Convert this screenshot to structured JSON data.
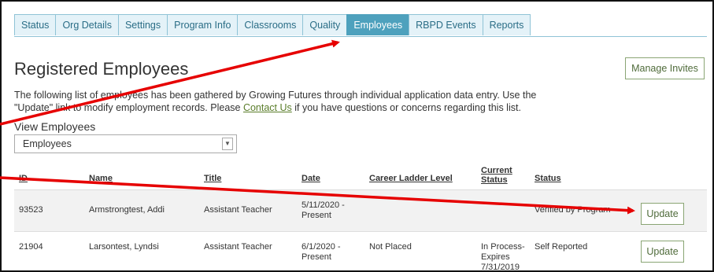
{
  "tabs": [
    {
      "label": "Status",
      "active": false
    },
    {
      "label": "Org Details",
      "active": false
    },
    {
      "label": "Settings",
      "active": false
    },
    {
      "label": "Program Info",
      "active": false
    },
    {
      "label": "Classrooms",
      "active": false
    },
    {
      "label": "Quality",
      "active": false
    },
    {
      "label": "Employees",
      "active": true
    },
    {
      "label": "RBPD Events",
      "active": false
    },
    {
      "label": "Reports",
      "active": false
    }
  ],
  "page": {
    "title": "Registered Employees",
    "manage_invites": "Manage Invites",
    "desc_part1": "The following list of employees has been gathered by Growing Futures through individual application data entry. Use the \"Update\" link to modify employment records. Please ",
    "desc_link": "Contact Us",
    "desc_part2": " if you have questions or concerns regarding this list."
  },
  "view": {
    "label": "View Employees",
    "selected": "Employees"
  },
  "table": {
    "headers": {
      "id": "ID",
      "name": "Name",
      "title": "Title",
      "date": "Date",
      "career": "Career Ladder Level",
      "current1": "Current",
      "current2": "Status",
      "status": "Status"
    },
    "rows": [
      {
        "id": "93523",
        "name": "Armstrongtest, Addi",
        "title": "Assistant Teacher",
        "date1": "5/11/2020 -",
        "date2": "Present",
        "career": "",
        "cur1": "",
        "cur2": "",
        "cur3": "",
        "status": "Verified by Program",
        "action": "Update"
      },
      {
        "id": "21904",
        "name": "Larsontest, Lyndsi",
        "title": "Assistant Teacher",
        "date1": "6/1/2020 -",
        "date2": "Present",
        "career": "Not Placed",
        "cur1": "In Process-",
        "cur2": "Expires",
        "cur3": "7/31/2019",
        "status": "Self Reported",
        "action": "Update"
      }
    ]
  },
  "colors": {
    "tab_active": "#4ea1bd",
    "tab_bg": "#e4f2f8",
    "button_border": "#8aa574",
    "annotation_arrow": "#e60000"
  }
}
